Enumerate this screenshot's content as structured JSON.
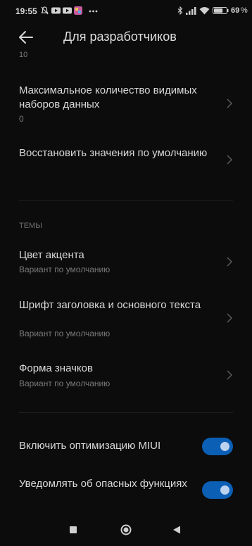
{
  "status_bar": {
    "time": "19:55",
    "icons": [
      "notifications-muted-icon",
      "youtube-icon",
      "youtube-icon",
      "app-icon",
      "more-dots-icon"
    ],
    "right_icons": [
      "bluetooth-icon",
      "signal-icon",
      "wifi-icon",
      "battery-icon"
    ],
    "battery": "69"
  },
  "header": {
    "title": "Для разработчиков",
    "back_icon": "arrow-left-icon"
  },
  "clipped_value": "10",
  "settings": [
    {
      "title": "Максимальное количество видимых наборов данных",
      "value": "0"
    },
    {
      "title": "Восстановить значения по умолчанию"
    }
  ],
  "themes_section": {
    "header": "ТЕМЫ",
    "items": [
      {
        "title": "Цвет акцента",
        "subtitle": "Вариант по умолчанию"
      },
      {
        "title": "Шрифт заголовка и основного текста",
        "subtitle": "Вариант по умолчанию"
      },
      {
        "title": "Форма значков",
        "subtitle": "Вариант по умолчанию"
      }
    ]
  },
  "toggles": [
    {
      "title": "Включить оптимизацию MIUI",
      "on": true
    },
    {
      "title": "Уведомлять об опасных функциях",
      "on": true
    }
  ],
  "colors": {
    "background": "#0c0c0c",
    "accent": "#0b5fb5"
  },
  "nav": [
    "recents-icon",
    "home-icon",
    "back-triangle-icon"
  ]
}
